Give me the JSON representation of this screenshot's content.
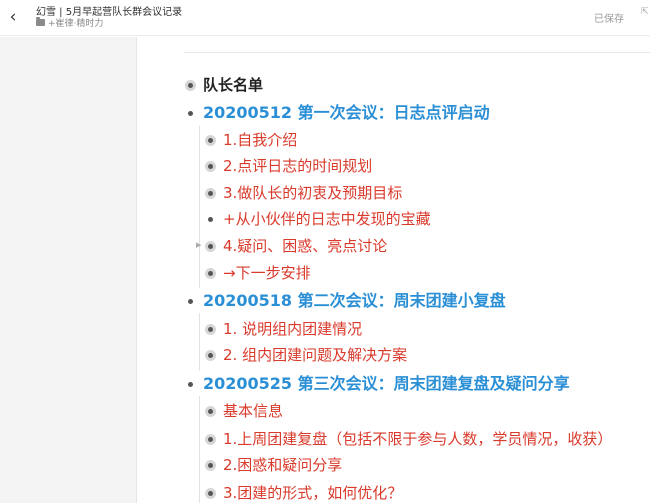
{
  "header": {
    "title": "幻雪 | 5月早起营队长群会议记录",
    "path": "+崔律·精时力",
    "save_status": "已保存",
    "expand_glyph": "⇱"
  },
  "outline": [
    {
      "text": "队长名单",
      "level": 0,
      "bullet": "collapsed"
    },
    {
      "text": "20200512 第一次会议：日志点评启动",
      "level": 1,
      "bullet": "dot"
    },
    {
      "text": "1.自我介绍",
      "level": 2,
      "bullet": "collapsed"
    },
    {
      "text": "2.点评日志的时间规划",
      "level": 2,
      "bullet": "collapsed"
    },
    {
      "text": "3.做队长的初衷及预期目标",
      "level": 2,
      "bullet": "collapsed"
    },
    {
      "text": "+从小伙伴的日志中发现的宝藏",
      "level": 2,
      "bullet": "dot"
    },
    {
      "text": "4.疑问、困惑、亮点讨论",
      "level": 2,
      "bullet": "collapsed"
    },
    {
      "text": "→下一步安排",
      "level": 2,
      "bullet": "collapsed"
    },
    {
      "text": "20200518 第二次会议：周末团建小复盘",
      "level": 1,
      "bullet": "dot"
    },
    {
      "text": "1. 说明组内团建情况",
      "level": 2,
      "bullet": "collapsed"
    },
    {
      "text": "2. 组内团建问题及解决方案",
      "level": 2,
      "bullet": "collapsed"
    },
    {
      "text": "20200525 第三次会议：周末团建复盘及疑问分享",
      "level": 1,
      "bullet": "dot"
    },
    {
      "text": "基本信息",
      "level": 2,
      "bullet": "collapsed"
    },
    {
      "text": "1.上周团建复盘（包括不限于参与人数，学员情况，收获）",
      "level": 2,
      "bullet": "collapsed"
    },
    {
      "text": "2.困惑和疑问分享",
      "level": 2,
      "bullet": "collapsed"
    },
    {
      "text": "3.团建的形式，如何优化？",
      "level": 2,
      "bullet": "collapsed"
    }
  ],
  "icons": {
    "back": "back-chevron-icon",
    "folder": "folder-icon",
    "expand": "expand-arrow-icon",
    "bullet": "outline-bullet-icon"
  },
  "colors": {
    "heading": "#2b8fd6",
    "item": "#d93a2b",
    "root": "#222222"
  }
}
